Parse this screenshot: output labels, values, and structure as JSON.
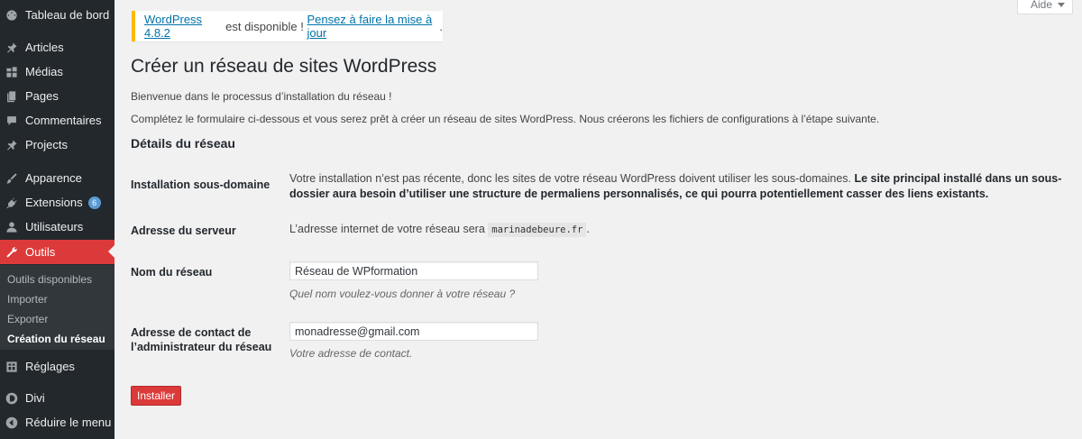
{
  "sidebar": {
    "items": [
      {
        "label": "Tableau de bord",
        "icon": "dashboard-icon"
      },
      {
        "label": "Articles",
        "icon": "pin-icon"
      },
      {
        "label": "Médias",
        "icon": "media-icon"
      },
      {
        "label": "Pages",
        "icon": "pages-icon"
      },
      {
        "label": "Commentaires",
        "icon": "comment-icon"
      },
      {
        "label": "Projects",
        "icon": "pin-icon"
      },
      {
        "label": "Apparence",
        "icon": "brush-icon"
      },
      {
        "label": "Extensions",
        "icon": "plugin-icon",
        "badge": "6"
      },
      {
        "label": "Utilisateurs",
        "icon": "user-icon"
      },
      {
        "label": "Outils",
        "icon": "wrench-icon"
      },
      {
        "label": "Réglages",
        "icon": "settings-icon"
      },
      {
        "label": "Divi",
        "icon": "divi-icon"
      },
      {
        "label": "Réduire le menu",
        "icon": "collapse-icon"
      }
    ],
    "submenu": [
      "Outils disponibles",
      "Importer",
      "Exporter",
      "Création du réseau"
    ],
    "active_color": "#dc3a3a"
  },
  "help_tab": {
    "label": "Aide"
  },
  "notice": {
    "version_link": "WordPress 4.8.2",
    "middle_text": " est disponible ! ",
    "update_link": "Pensez à faire la mise à jour",
    "end_text": "."
  },
  "page": {
    "title": "Créer un réseau de sites WordPress",
    "welcome": "Bienvenue dans le processus d’installation du réseau !",
    "intro": "Complétez le formulaire ci-dessous et vous serez prêt à créer un réseau de sites WordPress. Nous créerons les fichiers de configurations à l’étape suivante.",
    "section_title": "Détails du réseau"
  },
  "form": {
    "subdomain_label": "Installation sous-domaine",
    "subdomain_text": "Votre installation n’est pas récente, donc les sites de votre réseau WordPress doivent utiliser les sous-domaines. ",
    "subdomain_bold": "Le site principal installé dans un sous-dossier aura besoin d’utiliser une structure de permaliens personnalisés, ce qui pourra potentiellement casser des liens existants.",
    "server_label": "Adresse du serveur",
    "server_text": "L’adresse internet de votre réseau sera ",
    "server_value": "marinadebeure.fr",
    "server_end": ".",
    "network_name_label": "Nom du réseau",
    "network_name_value": "Réseau de WPformation",
    "network_name_desc": "Quel nom voulez-vous donner à votre réseau ?",
    "admin_email_label": "Adresse de contact de l’administrateur du réseau",
    "admin_email_value": "monadresse@gmail.com",
    "admin_email_desc": "Votre adresse de contact.",
    "submit_label": "Installer"
  }
}
